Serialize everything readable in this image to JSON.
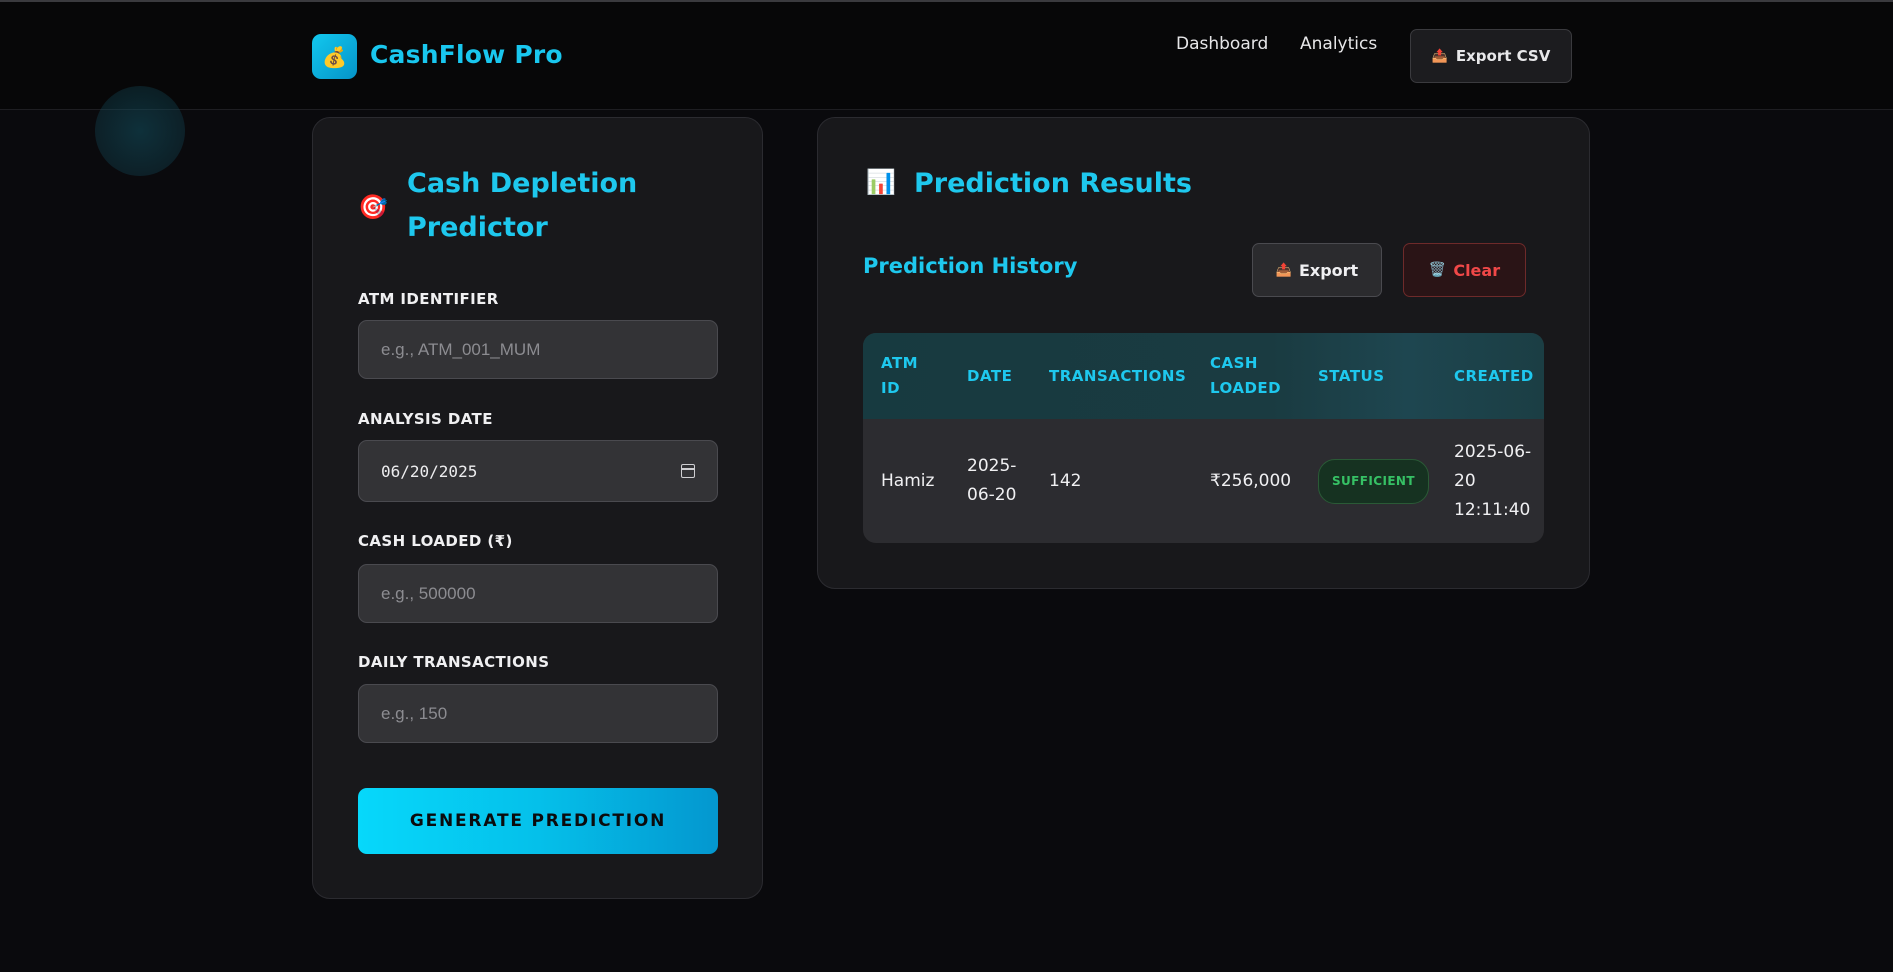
{
  "header": {
    "logo_icon": "money-bag-icon",
    "logo_glyph": "💰",
    "brand": "CashFlow Pro",
    "nav": {
      "dashboard": "Dashboard",
      "analytics": "Analytics"
    },
    "export_csv_icon": "📤",
    "export_csv_label": "Export CSV"
  },
  "form": {
    "title_icon": "🎯",
    "title_line1": "Cash Depletion",
    "title_line2": "Predictor",
    "atm_label": "ATM IDENTIFIER",
    "atm_placeholder": "e.g., ATM_001_MUM",
    "date_label": "ANALYSIS DATE",
    "date_value": "06/20/2025",
    "cash_label": "CASH LOADED (₹)",
    "cash_placeholder": "e.g., 500000",
    "tx_label": "DAILY TRANSACTIONS",
    "tx_placeholder": "e.g., 150",
    "submit_label": "GENERATE PREDICTION"
  },
  "results": {
    "title_icon": "📊",
    "title": "Prediction Results",
    "history_title": "Prediction History",
    "export_icon": "📤",
    "export_label": "Export",
    "clear_icon": "🗑️",
    "clear_label": "Clear",
    "columns": [
      "ATM ID",
      "DATE",
      "TRANSACTIONS",
      "CASH LOADED",
      "STATUS",
      "CREATED"
    ],
    "rows": [
      {
        "atm_id": "Hamiz",
        "date": "2025-06-20",
        "transactions": "142",
        "cash_loaded": "₹256,000",
        "status": "SUFFICIENT",
        "created": "2025-06-20 12:11:40"
      }
    ]
  },
  "colors": {
    "accent": "#1ec8ee",
    "danger": "#f04848",
    "success": "#36c165",
    "background": "#0a0a0d",
    "panel": "#18181b"
  }
}
